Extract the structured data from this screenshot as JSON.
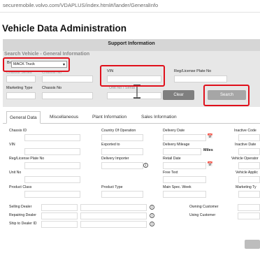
{
  "browser": {
    "url": "securemobile.volvo.com/VDAPLUS/index.html#/lander/GeneralInfo"
  },
  "page": {
    "title": "Vehicle Data Administration"
  },
  "support": {
    "title": "Support Information"
  },
  "search": {
    "section_title": "Search Vehicle - General Information",
    "brand_label": "Brand",
    "brand_value": "MACK Truck",
    "chassis_series_label": "Chassis Series",
    "chassis_no_label": "Chassis No",
    "vin_label": "VIN",
    "reg_label": "Reg/License Plate No",
    "marketing_type_label": "Marketing Type",
    "chassis_no2_label": "Chassis No",
    "unit_no_label": "Unit No / Serial",
    "clear_label": "Clear",
    "search_label": "Search"
  },
  "tabs": [
    {
      "label": "General Data"
    },
    {
      "label": "Miscellaneous"
    },
    {
      "label": "Plant Information"
    },
    {
      "label": "Sales Information"
    }
  ],
  "general": {
    "chassis_id": "Chassis ID",
    "country_of_operation": "Country Of Operation",
    "delivery_date": "Delivery Date",
    "inactive_code": "Inactive Code",
    "vin": "VIN",
    "exported_to": "Exported to",
    "delivery_mileage": "Delivery Mileage",
    "miles": "Miles",
    "inactive_date": "Inactive Date",
    "reg_license": "Reg/License Plate No",
    "delivery_importer": "Delivery Importer",
    "retail_date": "Retail Date",
    "vehicle_operator": "Vehicle Operator",
    "unit_no": "Unit No",
    "free_text": "Free Text",
    "vehicle_application": "Vehicle Applic",
    "product_class": "Product Class",
    "product_type": "Product Type",
    "main_spec_week": "Main Spec. Week",
    "marketing_type": "Marketing Ty",
    "selling_dealer": "Selling Dealer",
    "owning_customer": "Owning Customer",
    "repairing_dealer": "Repairing Dealer",
    "using_customer": "Using Customer",
    "ship_to_dealer_id": "Ship to Dealer ID"
  },
  "icons": {
    "calendar": "calendar-icon",
    "info": "info-icon",
    "dropdown": "chevron-down-icon",
    "cursor": "text-cursor-icon"
  },
  "colors": {
    "annotation": "#e0101b",
    "panel": "#e7e7e7",
    "button": "#7f7f7f"
  }
}
